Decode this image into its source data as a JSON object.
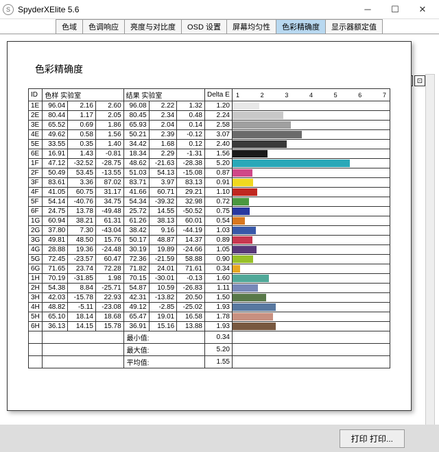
{
  "window": {
    "title": "SpyderXElite 5.6",
    "icon_label": "S"
  },
  "tabs": [
    "色域",
    "色调响应",
    "亮度与对比度",
    "OSD 设置",
    "屏幕均匀性",
    "色彩精确度",
    "显示器额定值"
  ],
  "active_tab_index": 5,
  "page_title": "色彩精确度",
  "headers": {
    "id": "ID",
    "sample": "色样 实验室",
    "result": "结果 实验室",
    "delta": "Delta E"
  },
  "axis_ticks": [
    "1",
    "2",
    "3",
    "4",
    "5",
    "6",
    "7"
  ],
  "axis_max": 7,
  "rows": [
    {
      "id": "1E",
      "s1": "96.04",
      "s2": "2.16",
      "s3": "2.60",
      "r1": "96.08",
      "r2": "2.22",
      "r3": "1.32",
      "d": "1.20",
      "color": "#e8e8e8"
    },
    {
      "id": "2E",
      "s1": "80.44",
      "s2": "1.17",
      "s3": "2.05",
      "r1": "80.45",
      "r2": "2.34",
      "r3": "0.48",
      "d": "2.24",
      "color": "#c8c8c8"
    },
    {
      "id": "3E",
      "s1": "65.52",
      "s2": "0.69",
      "s3": "1.86",
      "r1": "65.93",
      "r2": "2.04",
      "r3": "0.14",
      "d": "2.58",
      "color": "#a0a0a0"
    },
    {
      "id": "4E",
      "s1": "49.62",
      "s2": "0.58",
      "s3": "1.56",
      "r1": "50.21",
      "r2": "2.39",
      "r3": "-0.12",
      "d": "3.07",
      "color": "#6a6a6a"
    },
    {
      "id": "5E",
      "s1": "33.55",
      "s2": "0.35",
      "s3": "1.40",
      "r1": "34.42",
      "r2": "1.68",
      "r3": "0.12",
      "d": "2.40",
      "color": "#3a3a3a"
    },
    {
      "id": "6E",
      "s1": "16.91",
      "s2": "1.43",
      "s3": "-0.81",
      "r1": "18.34",
      "r2": "2.29",
      "r3": "-1.31",
      "d": "1.56",
      "color": "#1a1a1a"
    },
    {
      "id": "1F",
      "s1": "47.12",
      "s2": "-32.52",
      "s3": "-28.75",
      "r1": "48.62",
      "r2": "-21.63",
      "r3": "-28.38",
      "d": "5.20",
      "color": "#2aa8b8"
    },
    {
      "id": "2F",
      "s1": "50.49",
      "s2": "53.45",
      "s3": "-13.55",
      "r1": "51.03",
      "r2": "54.13",
      "r3": "-15.08",
      "d": "0.87",
      "color": "#d04888"
    },
    {
      "id": "3F",
      "s1": "83.61",
      "s2": "3.36",
      "s3": "87.02",
      "r1": "83.71",
      "r2": "3.97",
      "r3": "83.13",
      "d": "0.91",
      "color": "#f0d820"
    },
    {
      "id": "4F",
      "s1": "41.05",
      "s2": "60.75",
      "s3": "31.17",
      "r1": "41.66",
      "r2": "60.71",
      "r3": "29.21",
      "d": "1.10",
      "color": "#c02820"
    },
    {
      "id": "5F",
      "s1": "54.14",
      "s2": "-40.76",
      "s3": "34.75",
      "r1": "54.34",
      "r2": "-39.32",
      "r3": "32.98",
      "d": "0.72",
      "color": "#4a9840"
    },
    {
      "id": "6F",
      "s1": "24.75",
      "s2": "13.78",
      "s3": "-49.48",
      "r1": "25.72",
      "r2": "14.55",
      "r3": "-50.52",
      "d": "0.75",
      "color": "#2838a0"
    },
    {
      "id": "1G",
      "s1": "60.94",
      "s2": "38.21",
      "s3": "61.31",
      "r1": "61.26",
      "r2": "38.13",
      "r3": "60.01",
      "d": "0.54",
      "color": "#d87820"
    },
    {
      "id": "2G",
      "s1": "37.80",
      "s2": "7.30",
      "s3": "-43.04",
      "r1": "38.42",
      "r2": "9.16",
      "r3": "-44.19",
      "d": "1.03",
      "color": "#3858a8"
    },
    {
      "id": "3G",
      "s1": "49.81",
      "s2": "48.50",
      "s3": "15.76",
      "r1": "50.17",
      "r2": "48.87",
      "r3": "14.37",
      "d": "0.89",
      "color": "#c83850"
    },
    {
      "id": "4G",
      "s1": "28.88",
      "s2": "19.36",
      "s3": "-24.48",
      "r1": "30.19",
      "r2": "19.89",
      "r3": "-24.66",
      "d": "1.05",
      "color": "#583878"
    },
    {
      "id": "5G",
      "s1": "72.45",
      "s2": "-23.57",
      "s3": "60.47",
      "r1": "72.36",
      "r2": "-21.59",
      "r3": "58.88",
      "d": "0.90",
      "color": "#98c028"
    },
    {
      "id": "6G",
      "s1": "71.65",
      "s2": "23.74",
      "s3": "72.28",
      "r1": "71.82",
      "r2": "24.01",
      "r3": "71.61",
      "d": "0.34",
      "color": "#e8a820"
    },
    {
      "id": "1H",
      "s1": "70.19",
      "s2": "-31.85",
      "s3": "1.98",
      "r1": "70.15",
      "r2": "-30.01",
      "r3": "-0.13",
      "d": "1.60",
      "color": "#50a898"
    },
    {
      "id": "2H",
      "s1": "54.38",
      "s2": "8.84",
      "s3": "-25.71",
      "r1": "54.87",
      "r2": "10.59",
      "r3": "-26.83",
      "d": "1.11",
      "color": "#7888b8"
    },
    {
      "id": "3H",
      "s1": "42.03",
      "s2": "-15.78",
      "s3": "22.93",
      "r1": "42.31",
      "r2": "-13.82",
      "r3": "20.50",
      "d": "1.50",
      "color": "#587848"
    },
    {
      "id": "4H",
      "s1": "48.82",
      "s2": "-5.11",
      "s3": "-23.08",
      "r1": "49.12",
      "r2": "-2.85",
      "r3": "-25.02",
      "d": "1.93",
      "color": "#5878a0"
    },
    {
      "id": "5H",
      "s1": "65.10",
      "s2": "18.14",
      "s3": "18.68",
      "r1": "65.47",
      "r2": "19.01",
      "r3": "16.58",
      "d": "1.78",
      "color": "#c89080"
    },
    {
      "id": "6H",
      "s1": "36.13",
      "s2": "14.15",
      "s3": "15.78",
      "r1": "36.91",
      "r2": "15.16",
      "r3": "13.88",
      "d": "1.93",
      "color": "#785840"
    }
  ],
  "summary": {
    "min_label": "最小值:",
    "min": "0.34",
    "max_label": "最大值:",
    "max": "5.20",
    "avg_label": "平均值:",
    "avg": "1.55"
  },
  "footer": {
    "print": "打印 打印..."
  },
  "chart_data": {
    "type": "bar",
    "title": "色彩精确度",
    "xlabel": "Delta E",
    "xlim": [
      0,
      7
    ],
    "categories": [
      "1E",
      "2E",
      "3E",
      "4E",
      "5E",
      "6E",
      "1F",
      "2F",
      "3F",
      "4F",
      "5F",
      "6F",
      "1G",
      "2G",
      "3G",
      "4G",
      "5G",
      "6G",
      "1H",
      "2H",
      "3H",
      "4H",
      "5H",
      "6H"
    ],
    "values": [
      1.2,
      2.24,
      2.58,
      3.07,
      2.4,
      1.56,
      5.2,
      0.87,
      0.91,
      1.1,
      0.72,
      0.75,
      0.54,
      1.03,
      0.89,
      1.05,
      0.9,
      0.34,
      1.6,
      1.11,
      1.5,
      1.93,
      1.78,
      1.93
    ]
  }
}
